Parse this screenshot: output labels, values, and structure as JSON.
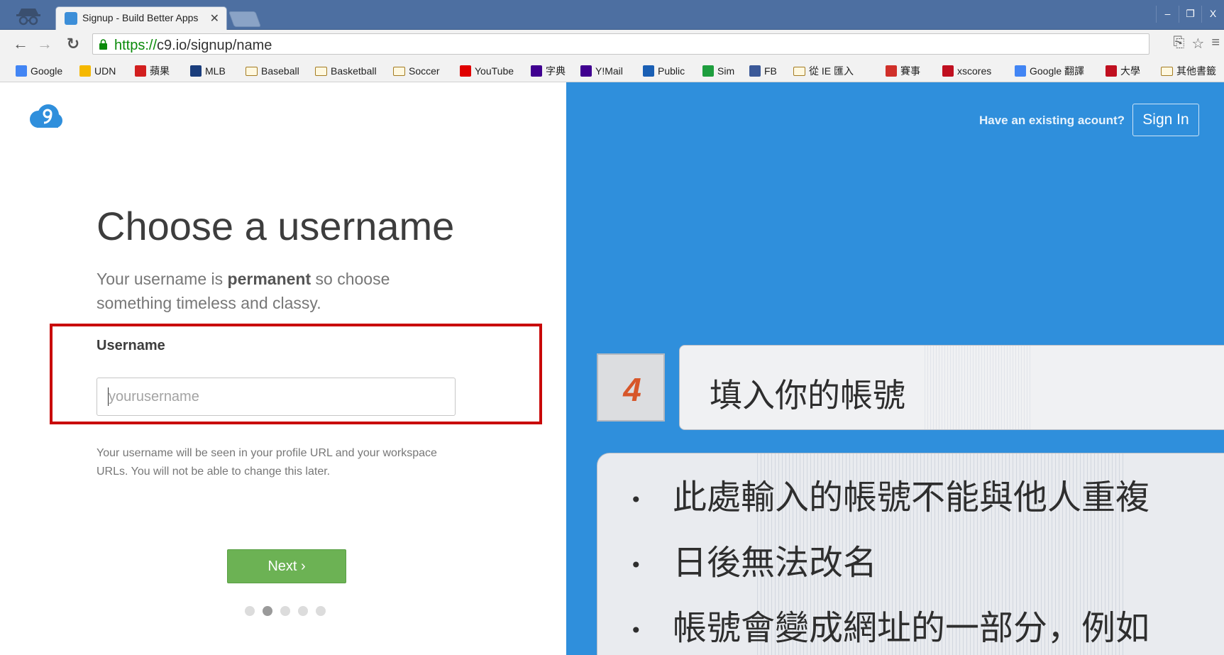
{
  "browser": {
    "tab_title": "Signup - Build Better Apps",
    "tab_close": "✕",
    "url_scheme": "https://",
    "url_rest": "c9.io/signup/name",
    "window_controls": [
      "–",
      "❐",
      "X"
    ]
  },
  "bookmarks": [
    {
      "label": "Google",
      "icon": "google-icon",
      "color": "#4285f4"
    },
    {
      "label": "UDN",
      "icon": "udn-icon",
      "color": "#f5b800"
    },
    {
      "label": "蘋果",
      "icon": "apple-daily-icon",
      "color": "#d21f1f"
    },
    {
      "label": "MLB",
      "icon": "mlb-icon",
      "color": "#1a3d7c"
    },
    {
      "label": "Baseball",
      "icon": "folder-icon",
      "color": "#a57c22"
    },
    {
      "label": "Basketball",
      "icon": "folder-icon",
      "color": "#a57c22"
    },
    {
      "label": "Soccer",
      "icon": "folder-icon",
      "color": "#a57c22"
    },
    {
      "label": "YouTube",
      "icon": "youtube-icon",
      "color": "#e00000"
    },
    {
      "label": "字典",
      "icon": "yahoo-icon",
      "color": "#400090"
    },
    {
      "label": "Y!Mail",
      "icon": "yahoo-icon",
      "color": "#400090"
    },
    {
      "label": "Public",
      "icon": "onedrive-icon",
      "color": "#1a5fb4"
    },
    {
      "label": "Sim",
      "icon": "sim-icon",
      "color": "#1e9e3e"
    },
    {
      "label": "FB",
      "icon": "facebook-icon",
      "color": "#3b5998"
    },
    {
      "label": "從 IE 匯入",
      "icon": "folder-icon",
      "color": "#a57c22"
    },
    {
      "label": "賽事",
      "icon": "score-icon",
      "color": "#d0302a"
    },
    {
      "label": "xscores",
      "icon": "xscores-icon",
      "color": "#c01020"
    },
    {
      "label": "Google 翻譯",
      "icon": "google-translate-icon",
      "color": "#4285f4"
    },
    {
      "label": "大學",
      "icon": "university-icon",
      "color": "#c01020"
    },
    {
      "label": "其他書籤",
      "icon": "folder-icon",
      "color": "#a57c22"
    }
  ],
  "signup": {
    "heading": "Choose a username",
    "subtitle_pre": "Your username is ",
    "subtitle_bold": "permanent",
    "subtitle_post": " so choose something timeless and classy.",
    "field_label": "Username",
    "field_placeholder": "yourusername",
    "field_value": "",
    "help_text": "Your username will be seen in your profile URL and your workspace URLs. You will not be able to change this later.",
    "next_label": "Next ›",
    "progress": {
      "total": 5,
      "current": 2
    },
    "existing_account_text": "Have an existing acount?",
    "signin_label": "Sign In"
  },
  "annotation": {
    "step_number": "4",
    "title": "填入你的帳號",
    "bullets": [
      "此處輸入的帳號不能與他人重複",
      "日後無法改名",
      "帳號會變成網址的一部分，例如"
    ],
    "bullet_symbol": "•"
  },
  "colors": {
    "brand_blue": "#2f8fdc",
    "next_green": "#6cb254",
    "highlight_red": "#c90808",
    "step_orange": "#d7562a"
  }
}
